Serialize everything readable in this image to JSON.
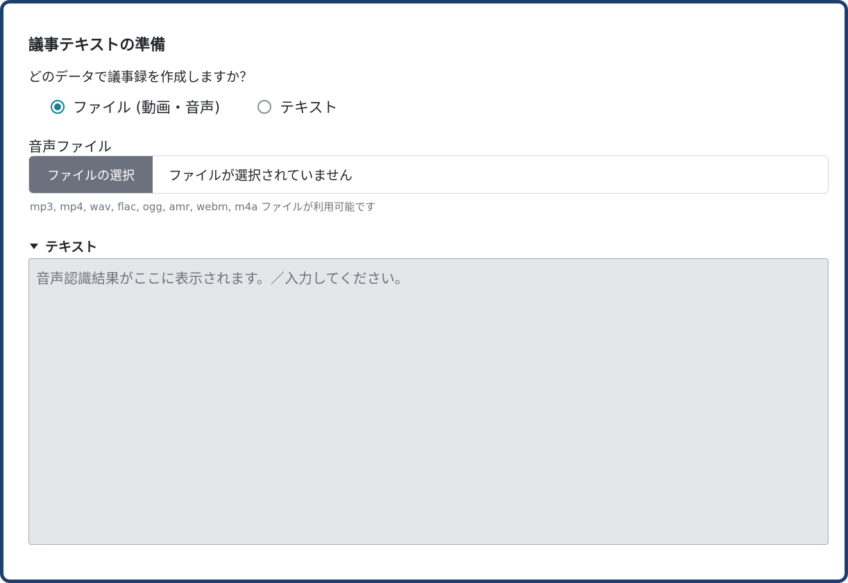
{
  "section": {
    "title": "議事テキストの準備",
    "question": "どのデータで議事録を作成しますか？"
  },
  "source_options": [
    {
      "label": "ファイル (動画・音声)",
      "selected": true
    },
    {
      "label": "テキスト",
      "selected": false
    }
  ],
  "audio_file": {
    "label": "音声ファイル",
    "button_label": "ファイルの選択",
    "status": "ファイルが選択されていません",
    "hint": "mp3, mp4, wav, flac, ogg, amr, webm, m4a ファイルが利用可能です"
  },
  "text_section": {
    "toggle_label": "テキスト",
    "placeholder": "音声認識結果がここに表示されます。／入力してください。"
  },
  "colors": {
    "panel_border": "#1c3f6e",
    "radio_accent": "#138197",
    "file_button_bg": "#6c727d",
    "textarea_bg": "#e5e6e9"
  }
}
